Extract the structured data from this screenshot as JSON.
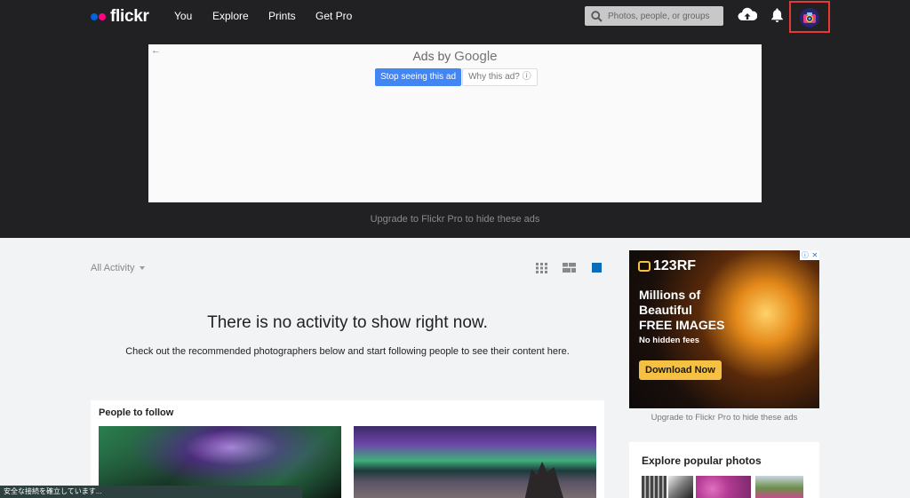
{
  "nav": {
    "brand": "flickr",
    "links": [
      "You",
      "Explore",
      "Prints",
      "Get Pro"
    ],
    "search_placeholder": "Photos, people, or groups"
  },
  "icons": {
    "search": "search-icon",
    "upload": "cloud-upload-icon",
    "notifications": "bell-icon",
    "avatar": "user-avatar"
  },
  "ad_banner": {
    "back": "←",
    "ads_by": "Ads by",
    "google": "Google",
    "stop_button": "Stop seeing this ad",
    "why_button": "Why this ad? ⓘ",
    "upgrade_text": "Upgrade to Flickr Pro to hide these ads"
  },
  "feed": {
    "filter_label": "All Activity",
    "empty_title": "There is no activity to show right now.",
    "empty_subtitle": "Check out the recommended photographers below and start following people to see their content here.",
    "people_to_follow_title": "People to follow"
  },
  "sidebar_ad": {
    "brand": "123RF",
    "headline_1": "Millions of",
    "headline_2": "Beautiful",
    "headline_3": "FREE IMAGES",
    "sub": "No hidden fees",
    "cta": "Download Now",
    "upgrade_text": "Upgrade to Flickr Pro to hide these ads"
  },
  "explore": {
    "title": "Explore popular photos"
  },
  "status_bar": {
    "text": "安全な接続を確立しています..."
  },
  "colors": {
    "header_bg": "#212124",
    "page_bg": "#f2f3f5",
    "flickr_blue": "#0063dc",
    "flickr_pink": "#ff0084",
    "google_blue": "#4285f4",
    "highlight_red": "#e53935"
  }
}
